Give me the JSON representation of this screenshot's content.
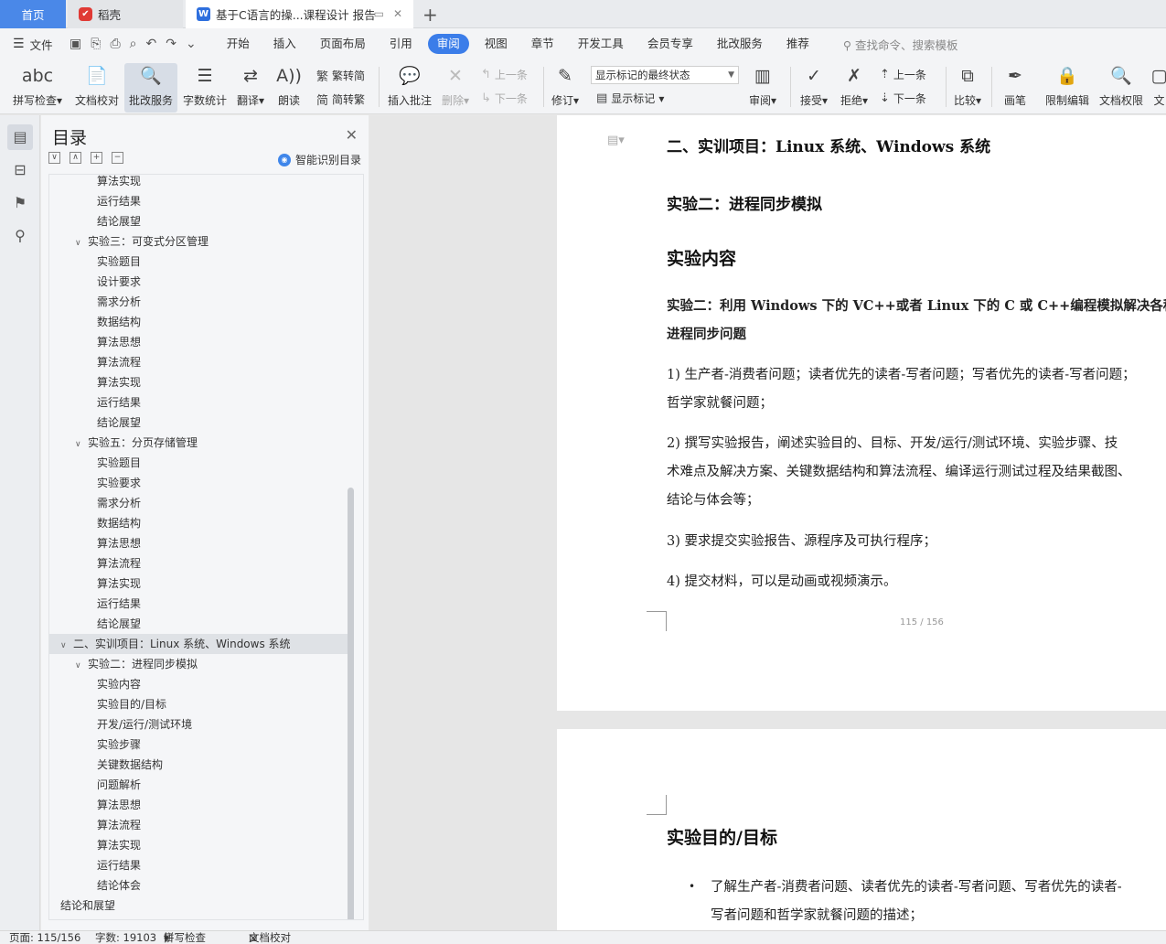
{
  "tabs": {
    "home": "首页",
    "daoke": "稻壳",
    "doc_title": "基于C语言的操...课程设计 报告"
  },
  "menubar": {
    "file": "文件",
    "items": [
      "开始",
      "插入",
      "页面布局",
      "引用",
      "审阅",
      "视图",
      "章节",
      "开发工具",
      "会员专享",
      "批改服务",
      "推荐"
    ],
    "active": "审阅",
    "search_placeholder": "查找命令、搜索模板"
  },
  "ribbon": {
    "spell": "拼写检查",
    "proof": "文档校对",
    "correct_service": "批改服务",
    "word_count": "字数统计",
    "translate": "翻译",
    "read_aloud": "朗读",
    "trad": "繁转简",
    "simp": "简转繁",
    "insert_comment": "插入批注",
    "delete": "删除",
    "prev_comment": "上一条",
    "next_comment": "下一条",
    "revise": "修订",
    "markup_state": "显示标记的最终状态",
    "show_markup": "显示标记",
    "review": "审阅",
    "accept": "接受",
    "reject": "拒绝",
    "prev": "上一条",
    "next": "下一条",
    "compare": "比较",
    "pen": "画笔",
    "restrict": "限制编辑",
    "permission": "文档权限",
    "cut_label": "文"
  },
  "toc": {
    "title": "目录",
    "ai_label": "智能识别目录",
    "items": [
      {
        "level": 3,
        "text": "算法实现"
      },
      {
        "level": 3,
        "text": "运行结果"
      },
      {
        "level": 3,
        "text": "结论展望"
      },
      {
        "level": 2,
        "text": "实验三：可变式分区管理",
        "expanded": true
      },
      {
        "level": 3,
        "text": "实验题目"
      },
      {
        "level": 3,
        "text": "设计要求"
      },
      {
        "level": 3,
        "text": "需求分析"
      },
      {
        "level": 3,
        "text": "数据结构"
      },
      {
        "level": 3,
        "text": "算法思想"
      },
      {
        "level": 3,
        "text": "算法流程"
      },
      {
        "level": 3,
        "text": "算法实现"
      },
      {
        "level": 3,
        "text": "运行结果"
      },
      {
        "level": 3,
        "text": "结论展望"
      },
      {
        "level": 2,
        "text": "实验五：分页存储管理",
        "expanded": true
      },
      {
        "level": 3,
        "text": "实验题目"
      },
      {
        "level": 3,
        "text": "实验要求"
      },
      {
        "level": 3,
        "text": "需求分析"
      },
      {
        "level": 3,
        "text": "数据结构"
      },
      {
        "level": 3,
        "text": "算法思想"
      },
      {
        "level": 3,
        "text": "算法流程"
      },
      {
        "level": 3,
        "text": "算法实现"
      },
      {
        "level": 3,
        "text": "运行结果"
      },
      {
        "level": 3,
        "text": "结论展望"
      },
      {
        "level": 1,
        "text": "二、实训项目：Linux 系统、Windows 系统",
        "expanded": true,
        "selected": true
      },
      {
        "level": 2,
        "text": "实验二：进程同步模拟",
        "expanded": true
      },
      {
        "level": 3,
        "text": "实验内容"
      },
      {
        "level": 3,
        "text": "实验目的/目标"
      },
      {
        "level": 3,
        "text": "开发/运行/测试环境"
      },
      {
        "level": 3,
        "text": "实验步骤"
      },
      {
        "level": 3,
        "text": "关键数据结构"
      },
      {
        "level": 3,
        "text": "问题解析"
      },
      {
        "level": 3,
        "text": "算法思想"
      },
      {
        "level": 3,
        "text": "算法流程"
      },
      {
        "level": 3,
        "text": "算法实现"
      },
      {
        "level": 3,
        "text": "运行结果"
      },
      {
        "level": 3,
        "text": "结论体会"
      },
      {
        "level": 1,
        "text": "结论和展望"
      }
    ]
  },
  "document": {
    "heading_section": "二、实训项目：Linux 系统、Windows 系统",
    "heading_exp": "实验二：进程同步模拟",
    "heading_content": "实验内容",
    "bold_para_line1": "实验二：利用 Windows 下的 VC++或者 Linux 下的 C 或 C++编程模拟解决各种",
    "bold_para_line2": "进程同步问题",
    "p1_line1": "1) 生产者-消费者问题；读者优先的读者-写者问题；写者优先的读者-写者问题；",
    "p1_line2": "哲学家就餐问题；",
    "p2_line1": "2) 撰写实验报告，阐述实验目的、目标、开发/运行/测试环境、实验步骤、技",
    "p2_line2": "术难点及解决方案、关键数据结构和算法流程、编译运行测试过程及结果截图、",
    "p2_line3": "结论与体会等；",
    "p3": "3) 要求提交实验报告、源程序及可执行程序；",
    "p4": "4) 提交材料，可以是动画或视频演示。",
    "page_number": "115 / 156",
    "heading_goal": "实验目的/目标",
    "bullet_line1": "了解生产者-消费者问题、读者优先的读者-写者问题、写者优先的读者-",
    "bullet_line2": "写者问题和哲学家就餐问题的描述；"
  },
  "status": {
    "page": "页面: 115/156",
    "words": "字数: 19103",
    "spell": "拼写检查",
    "proof": "文档校对"
  }
}
